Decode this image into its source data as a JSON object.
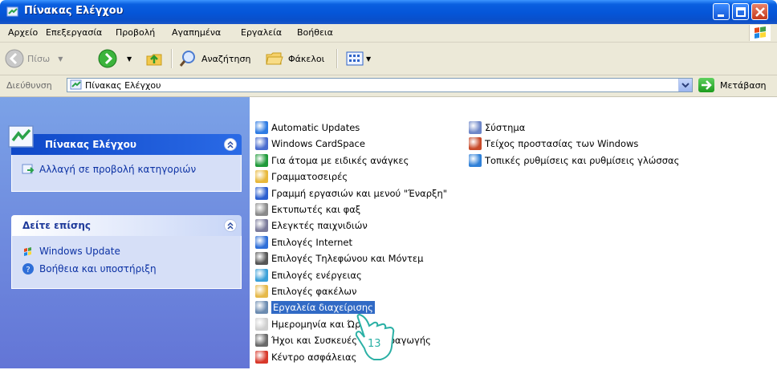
{
  "window": {
    "title": "Πίνακας Ελέγχου"
  },
  "menu": [
    "Αρχείο",
    "Επεξεργασία",
    "Προβολή",
    "Αγαπημένα",
    "Εργαλεία",
    "Βοήθεια"
  ],
  "toolbar": {
    "back": "Πίσω",
    "search": "Αναζήτηση",
    "folders": "Φάκελοι"
  },
  "address": {
    "label": "Διεύθυνση",
    "value": "Πίνακας Ελέγχου",
    "go": "Μετάβαση"
  },
  "taskpane": {
    "main_title": "Πίνακας Ελέγχου",
    "main_links": [
      "Αλλαγή σε προβολή κατηγοριών"
    ],
    "see_also_title": "Δείτε επίσης",
    "see_also_links": [
      "Windows Update",
      "Βοήθεια και υποστήριξη"
    ]
  },
  "items_col1": [
    {
      "label": "Automatic Updates",
      "icon": "automatic-updates-icon",
      "color": "#2e7be3"
    },
    {
      "label": "Windows CardSpace",
      "icon": "cardspace-icon",
      "color": "#4a6ccf"
    },
    {
      "label": "Για άτομα με ειδικές ανάγκες",
      "icon": "accessibility-icon",
      "color": "#1f9a3a"
    },
    {
      "label": "Γραμματοσειρές",
      "icon": "fonts-icon",
      "color": "#e8b83a"
    },
    {
      "label": "Γραμμή εργασιών και μενού \"Έναρξη\"",
      "icon": "taskbar-icon",
      "color": "#2c5fcf"
    },
    {
      "label": "Εκτυπωτές και φαξ",
      "icon": "printers-icon",
      "color": "#8a8a8a"
    },
    {
      "label": "Ελεγκτές παιχνιδιών",
      "icon": "game-controllers-icon",
      "color": "#7a7a9a"
    },
    {
      "label": "Επιλογές Internet",
      "icon": "internet-options-icon",
      "color": "#2f6fd8"
    },
    {
      "label": "Επιλογές Τηλεφώνου και Μόντεμ",
      "icon": "phone-modem-icon",
      "color": "#555555"
    },
    {
      "label": "Επιλογές ενέργειας",
      "icon": "power-options-icon",
      "color": "#3aa0d8"
    },
    {
      "label": "Επιλογές φακέλων",
      "icon": "folder-options-icon",
      "color": "#e6b94a"
    },
    {
      "label": "Εργαλεία διαχείρισης",
      "icon": "admin-tools-icon",
      "color": "#6b8bb0",
      "selected": true
    },
    {
      "label": "Ημερομηνία και Ώρα",
      "icon": "date-time-icon",
      "color": "#cfcfcf"
    },
    {
      "label": "Ήχοι και Συσκευές αναπαραγωγής",
      "icon": "sounds-icon",
      "color": "#6a6a6a"
    },
    {
      "label": "Κέντρο ασφάλειας",
      "icon": "security-center-icon",
      "color": "#d8382a"
    }
  ],
  "items_col2": [
    {
      "label": "Σύστημα",
      "icon": "system-icon",
      "color": "#6d86c8"
    },
    {
      "label": "Τείχος προστασίας των Windows",
      "icon": "firewall-icon",
      "color": "#c84a2a"
    },
    {
      "label": "Τοπικές ρυθμίσεις και ρυθμίσεις γλώσσας",
      "icon": "regional-icon",
      "color": "#2f80d8"
    }
  ],
  "annotation": {
    "step": "13"
  },
  "colors": {
    "title_blue": "#0555d8",
    "pane_blue": "#6f8ee0",
    "link": "#0c32a4",
    "selection": "#316ac5"
  }
}
